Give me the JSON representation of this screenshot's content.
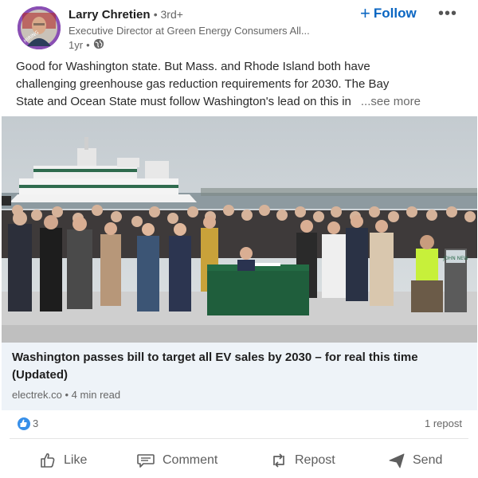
{
  "post": {
    "author": {
      "name": "Larry Chretien",
      "connection": "3rd+",
      "headline": "Executive Director at Green Energy Consumers All...",
      "time": "1yr",
      "avatar_badge": "HIRING",
      "avatar_ring_color": "#8a4fb4"
    },
    "follow_label": "Follow",
    "text_lines": [
      "Good for Washington state. But Mass. and Rhode Island both have",
      "challenging greenhouse gas reduction requirements for 2030. The Bay",
      "State and Ocean State must follow Washington's lead on this in"
    ],
    "see_more": "...see more",
    "image_sign": "JOHN NEW",
    "link": {
      "title": "Washington passes bill to target all EV sales by 2030 – for real this time (Updated)",
      "source": "electrek.co",
      "read_time": "4 min read"
    },
    "social": {
      "reaction_count": "3",
      "repost_count": "1 repost"
    },
    "actions": [
      {
        "label": "Like",
        "icon": "thumbs-up-icon"
      },
      {
        "label": "Comment",
        "icon": "comment-icon"
      },
      {
        "label": "Repost",
        "icon": "repost-icon"
      },
      {
        "label": "Send",
        "icon": "send-icon"
      }
    ]
  },
  "colors": {
    "brand_blue": "#0a66c2",
    "link_bg": "#eef3f8",
    "table_green": "#1f5e3c"
  }
}
